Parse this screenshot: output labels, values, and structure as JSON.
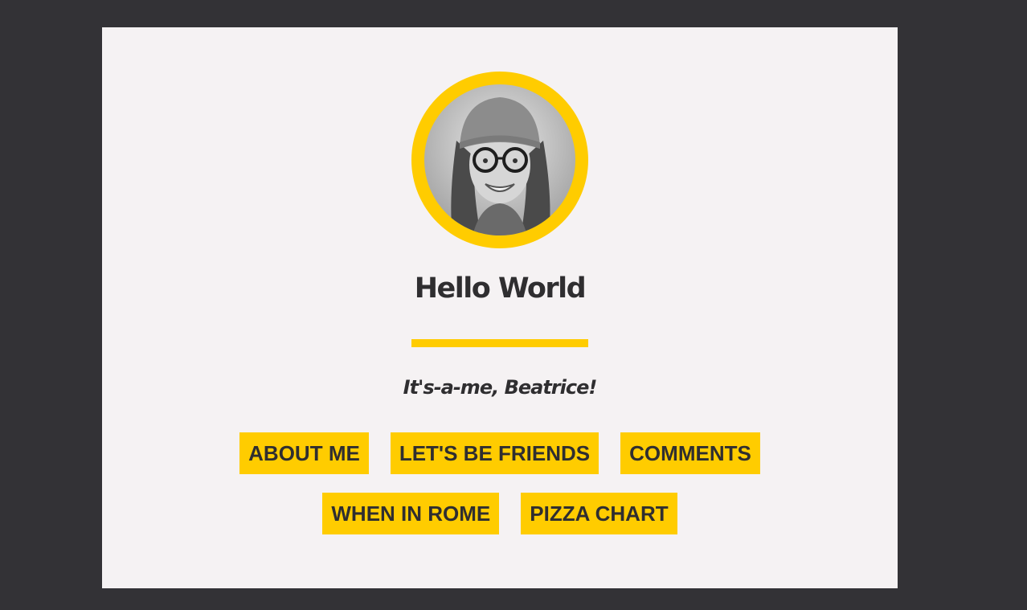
{
  "profile": {
    "title": "Hello World",
    "subtitle": "It's-a-me, Beatrice!"
  },
  "nav": {
    "row1": [
      {
        "label": "ABOUT ME"
      },
      {
        "label": "LET'S BE FRIENDS"
      },
      {
        "label": "COMMENTS"
      }
    ],
    "row2": [
      {
        "label": "WHEN IN ROME"
      },
      {
        "label": "PIZZA CHART"
      }
    ]
  },
  "colors": {
    "background": "#333236",
    "card": "#f5f2f3",
    "accent": "#ffcc00",
    "text": "#2f2e30"
  }
}
